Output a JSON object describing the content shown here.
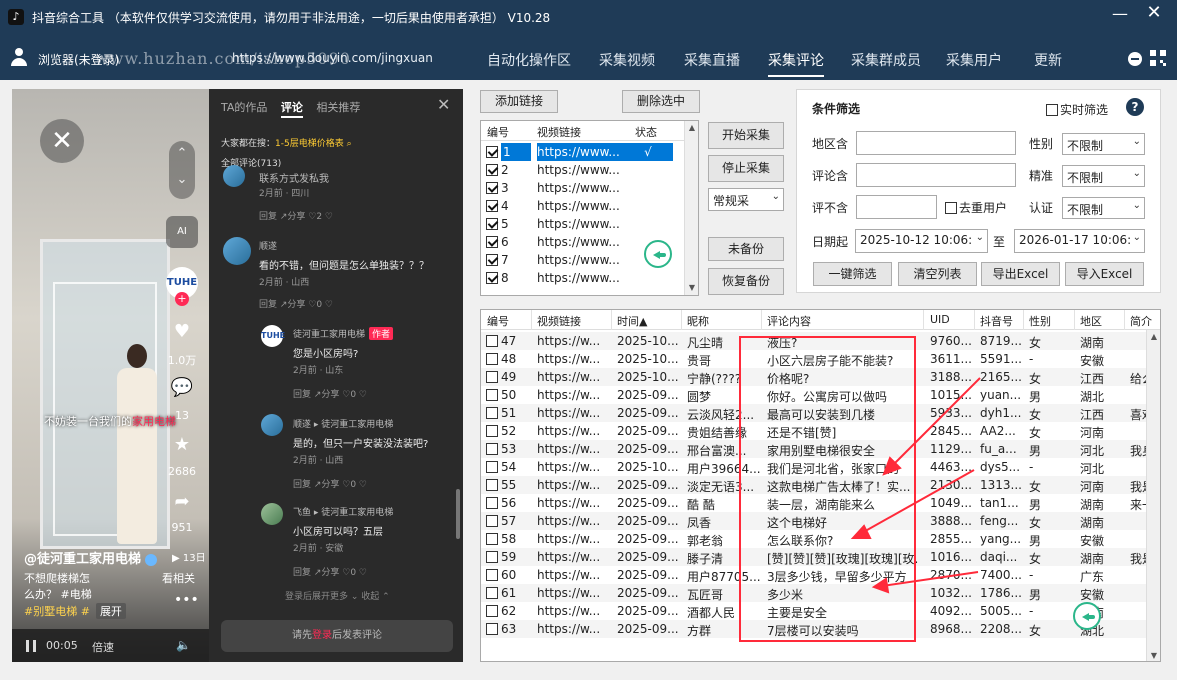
{
  "window": {
    "app_icon": "tiktok-note-icon",
    "title": "抖音综合工具 （本软件仅供学习交流使用，请勿用于非法用途，一切后果由使用者承担） V10.28",
    "minimize": "—",
    "close": "✕"
  },
  "nav": {
    "browser_label": "浏览器(未登录)",
    "url": "https://www.douyin.com/jingxuan",
    "watermark": "www.huzhan.com/ishop5090",
    "tabs": [
      "自动化操作区",
      "采集视频",
      "采集直播",
      "采集评论",
      "采集群成员",
      "采集用户",
      "更新"
    ],
    "active_tab": "采集评论"
  },
  "video": {
    "ai": "AI",
    "brand": "TUHE",
    "plus": "+",
    "like_count": "1.0万",
    "comment_count": "13",
    "fav_count": "2686",
    "share_count": "951",
    "caption_pre": "不妨装一台我们的",
    "caption_hl": "家用电梯",
    "author": "@徒河重工家用电梯",
    "play_chip": "▶ 13日",
    "desc1": "不想爬楼梯怎",
    "desc_more": "看相关",
    "desc2": "么办？ #电梯",
    "desc3": "#别墅电梯  #",
    "expand": "展开",
    "time": "00:05",
    "speed": "倍速"
  },
  "comments_panel": {
    "tabs": [
      "TA的作品",
      "评论",
      "相关推荐"
    ],
    "active_tab": "评论",
    "search_tip_pre": "大家都在搜：",
    "search_tip_hl": "1-5层电梯价格表",
    "count": "全部评论(713)",
    "items": [
      {
        "user": "",
        "text": "联系方式发私我",
        "meta": "2月前 · 四川",
        "actions": "回复   ↗分享   ♡2   ♡"
      },
      {
        "user": "顺遂",
        "text": "看的不错，但问题是怎么单独装？？？",
        "meta": "2月前 · 山西",
        "actions": "回复   ↗分享   ♡0   ♡"
      },
      {
        "user": "徒河重工家用电梯",
        "tag": "作者",
        "text": "您是小区房吗?",
        "meta": "2月前 · 山东",
        "actions": "回复   ↗分享   ♡0   ♡"
      },
      {
        "user": "顺遂 ▸ 徒河重工家用电梯",
        "text": "是的，但只一户安装没法装吧?",
        "meta": "2月前 · 山西",
        "actions": "回复   ↗分享   ♡0   ♡"
      },
      {
        "user": "飞鱼 ▸ 徒河重工家用电梯",
        "text": "小区房可以吗？五层",
        "meta": "2月前 · 安徽",
        "actions": "回复   ↗分享   ♡0   ♡"
      }
    ],
    "more_replies": "登录后展开更多 ⌄   收起 ⌃",
    "login_pre": "请先",
    "login_hl": "登录",
    "login_post": "后发表评论"
  },
  "links": {
    "add_button": "添加链接",
    "delete_button": "删除选中",
    "columns": [
      "编号",
      "视频链接",
      "状态"
    ],
    "rows": [
      {
        "id": "1",
        "link": "https://www...",
        "status": "√",
        "checked": true,
        "selected": true
      },
      {
        "id": "2",
        "link": "https://www...",
        "status": "",
        "checked": true
      },
      {
        "id": "3",
        "link": "https://www...",
        "status": "",
        "checked": true
      },
      {
        "id": "4",
        "link": "https://www...",
        "status": "",
        "checked": true
      },
      {
        "id": "5",
        "link": "https://www...",
        "status": "",
        "checked": true
      },
      {
        "id": "6",
        "link": "https://www...",
        "status": "",
        "checked": true
      },
      {
        "id": "7",
        "link": "https://www...",
        "status": "",
        "checked": true
      },
      {
        "id": "8",
        "link": "https://www...",
        "status": "",
        "checked": true
      }
    ]
  },
  "controls": {
    "start": "开始采集",
    "stop": "停止采集",
    "mode": "常规采",
    "unbackup": "未备份",
    "restore": "恢复备份"
  },
  "filter": {
    "title": "条件筛选",
    "realtime": "实时筛选",
    "help": "?",
    "region_label": "地区含",
    "region_value": "",
    "gender_label": "性别",
    "gender_value": "不限制",
    "comment_label": "评论含",
    "comment_value": "",
    "precise_label": "精准",
    "precise_value": "不限制",
    "exclude_label": "评不含",
    "exclude_value": "",
    "dedupe": "去重用户",
    "verify_label": "认证",
    "verify_value": "不限制",
    "date_label": "日期起",
    "date_from": "2025-10-12 10:06:",
    "date_to_label": "至",
    "date_to": "2026-01-17 10:06:",
    "buttons": [
      "一键筛选",
      "清空列表",
      "导出Excel",
      "导入Excel"
    ]
  },
  "table": {
    "columns": [
      "编号",
      "视频链接",
      "时间▲",
      "昵称",
      "评论内容",
      "UID",
      "抖音号",
      "性别",
      "地区",
      "简介"
    ],
    "rows": [
      {
        "id": "47",
        "link": "https://w...",
        "time": "2025-10...",
        "nick": "凡尘晴",
        "content": "液压?",
        "uid": "9760...",
        "dy": "8719...",
        "sex": "女",
        "area": "湖南",
        "bio": ""
      },
      {
        "id": "48",
        "link": "https://w...",
        "time": "2025-10...",
        "nick": "贵哥",
        "content": "小区六层房子能不能装?",
        "uid": "3611...",
        "dy": "5591...",
        "sex": "-",
        "area": "安徽",
        "bio": ""
      },
      {
        "id": "49",
        "link": "https://w...",
        "time": "2025-10...",
        "nick": "宁静(????",
        "content": "价格呢?",
        "uid": "3188...",
        "dy": "2165...",
        "sex": "女",
        "area": "江西",
        "bio": "给么"
      },
      {
        "id": "50",
        "link": "https://w...",
        "time": "2025-09...",
        "nick": "圆梦",
        "content": "你好。公寓房可以做吗",
        "uid": "1015...",
        "dy": "yuan...",
        "sex": "男",
        "area": "湖北",
        "bio": ""
      },
      {
        "id": "51",
        "link": "https://w...",
        "time": "2025-09...",
        "nick": "云淡风轻2...",
        "content": "最高可以安装到几楼",
        "uid": "5933...",
        "dy": "dyh1...",
        "sex": "女",
        "area": "江西",
        "bio": "喜欢"
      },
      {
        "id": "52",
        "link": "https://w...",
        "time": "2025-09...",
        "nick": "贵姐结善缘",
        "content": "还是不错[赞]",
        "uid": "2845...",
        "dy": "AA2...",
        "sex": "女",
        "area": "河南",
        "bio": ""
      },
      {
        "id": "53",
        "link": "https://w...",
        "time": "2025-09...",
        "nick": "邢台富澳...",
        "content": "家用别墅电梯很安全",
        "uid": "1129...",
        "dy": "fu_a...",
        "sex": "男",
        "area": "河北",
        "bio": "我身"
      },
      {
        "id": "54",
        "link": "https://w...",
        "time": "2025-10...",
        "nick": "用户39664...",
        "content": "我们是河北省，张家口的",
        "uid": "4463...",
        "dy": "dys5...",
        "sex": "-",
        "area": "河北",
        "bio": ""
      },
      {
        "id": "55",
        "link": "https://w...",
        "time": "2025-09...",
        "nick": "淡定无语3...",
        "content": "这款电梯广告太棒了！实...",
        "uid": "2130...",
        "dy": "1313...",
        "sex": "女",
        "area": "河南",
        "bio": "我是"
      },
      {
        "id": "56",
        "link": "https://w...",
        "time": "2025-09...",
        "nick": "酷 酷",
        "content": "装一层，湖南能来么",
        "uid": "1049...",
        "dy": "tan1...",
        "sex": "男",
        "area": "湖南",
        "bio": "来一"
      },
      {
        "id": "57",
        "link": "https://w...",
        "time": "2025-09...",
        "nick": "凤香",
        "content": "这个电梯好",
        "uid": "3888...",
        "dy": "feng...",
        "sex": "女",
        "area": "湖南",
        "bio": ""
      },
      {
        "id": "58",
        "link": "https://w...",
        "time": "2025-09...",
        "nick": "郭老翁",
        "content": "怎么联系你?",
        "uid": "2855...",
        "dy": "yang...",
        "sex": "男",
        "area": "安徽",
        "bio": ""
      },
      {
        "id": "59",
        "link": "https://w...",
        "time": "2025-09...",
        "nick": "滕子清",
        "content": "[赞][赞][赞][玫瑰][玫瑰][玫...",
        "uid": "1016...",
        "dy": "daqi...",
        "sex": "女",
        "area": "湖南",
        "bio": "我是"
      },
      {
        "id": "60",
        "link": "https://w...",
        "time": "2025-09...",
        "nick": "用户87705...",
        "content": "3层多少钱，早留多少平方",
        "uid": "2870...",
        "dy": "7400...",
        "sex": "-",
        "area": "广东",
        "bio": ""
      },
      {
        "id": "61",
        "link": "https://w...",
        "time": "2025-09...",
        "nick": "瓦匠哥",
        "content": "多少米",
        "uid": "1032...",
        "dy": "1786...",
        "sex": "男",
        "area": "安徽",
        "bio": ""
      },
      {
        "id": "62",
        "link": "https://w...",
        "time": "2025-09...",
        "nick": "酒都人民",
        "content": "主要是安全",
        "uid": "4092...",
        "dy": "5005...",
        "sex": "-",
        "area": "河南",
        "bio": ""
      },
      {
        "id": "63",
        "link": "https://w...",
        "time": "2025-09...",
        "nick": "方群",
        "content": "7层楼可以安装吗",
        "uid": "8968...",
        "dy": "2208...",
        "sex": "女",
        "area": "湖北",
        "bio": ""
      }
    ]
  },
  "colors": {
    "nav_bg": "#1f3b57",
    "select_blue": "#0078d7",
    "highlight_red": "#ff2a3a",
    "back_green": "#2bb68a"
  }
}
